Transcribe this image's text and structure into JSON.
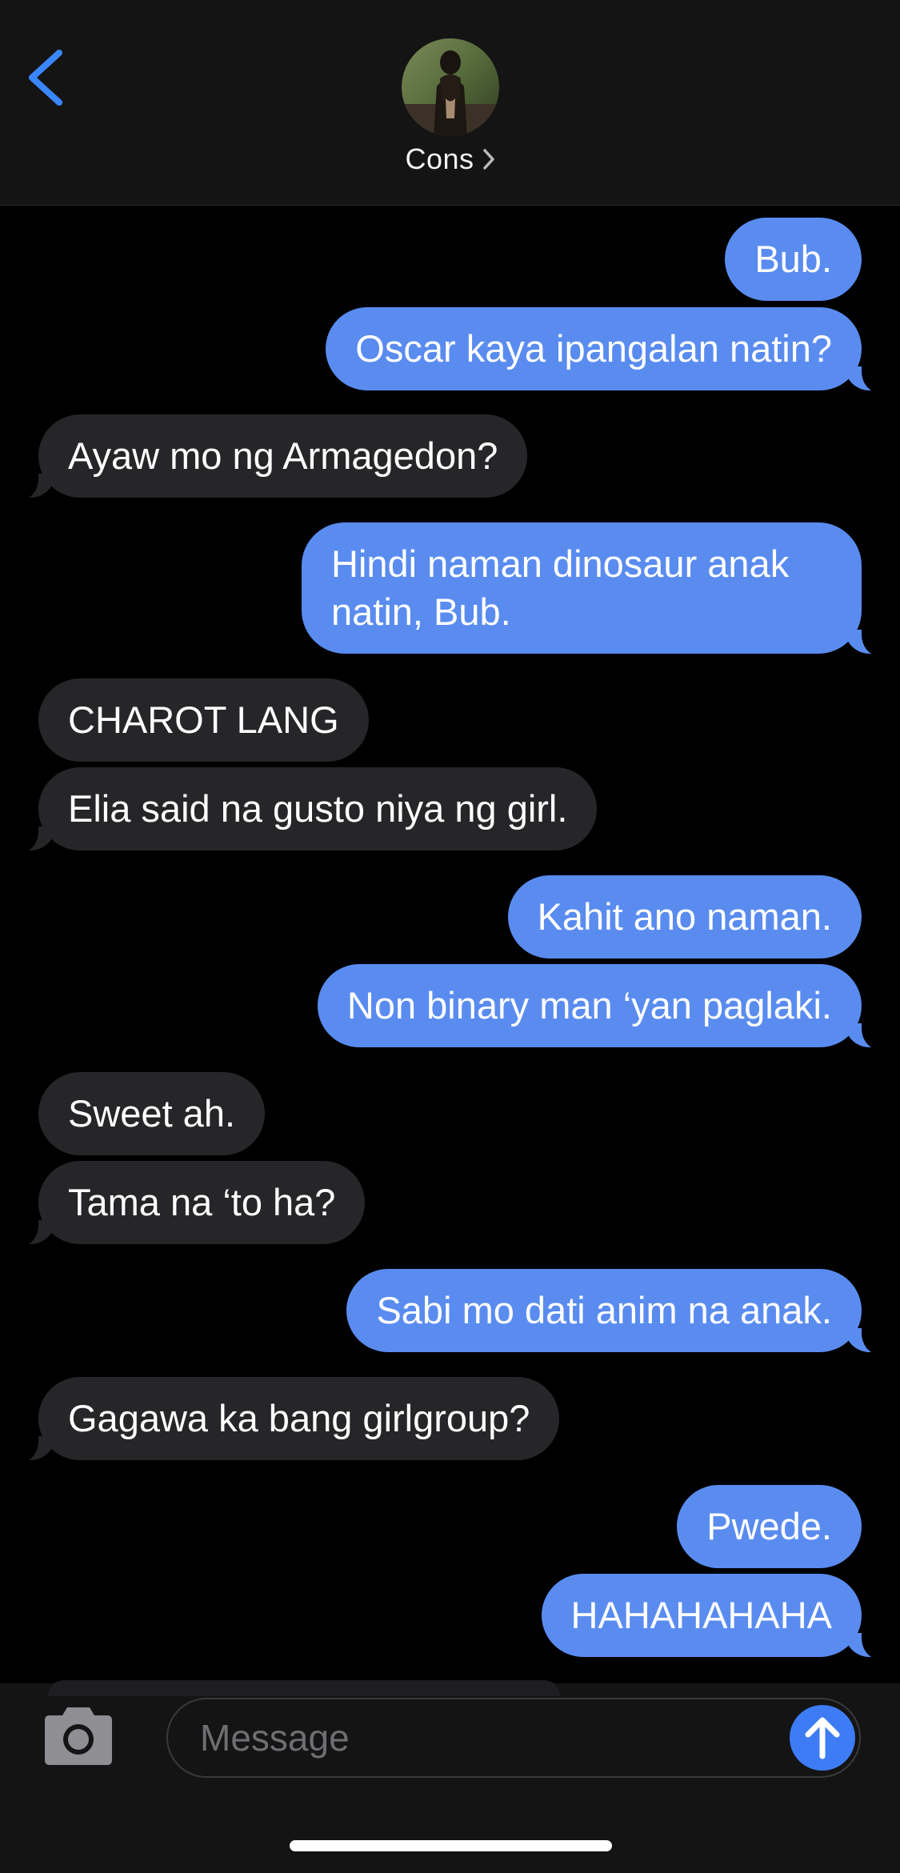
{
  "header": {
    "contact_name": "Cons",
    "back_icon": "chevron-left-icon",
    "contact_chevron_icon": "chevron-right-icon"
  },
  "messages": [
    {
      "from": "me",
      "text": "Bub."
    },
    {
      "from": "me",
      "text": "Oscar kaya ipangalan natin?"
    },
    {
      "from": "them",
      "text": "Ayaw mo ng Armagedon?"
    },
    {
      "from": "me",
      "text": "Hindi naman dinosaur anak natin, Bub."
    },
    {
      "from": "them",
      "text": "CHAROT LANG"
    },
    {
      "from": "them",
      "text": "Elia said na gusto niya ng girl."
    },
    {
      "from": "me",
      "text": "Kahit ano naman."
    },
    {
      "from": "me",
      "text": "Non binary man ‘yan paglaki."
    },
    {
      "from": "them",
      "text": "Sweet ah."
    },
    {
      "from": "them",
      "text": "Tama na ‘to ha?"
    },
    {
      "from": "me",
      "text": "Sabi mo dati anim na anak."
    },
    {
      "from": "them",
      "text": "Gagawa ka bang girlgroup?"
    },
    {
      "from": "me",
      "text": "Pwede."
    },
    {
      "from": "me",
      "text": "HAHAHAHAHA"
    }
  ],
  "composer": {
    "placeholder": "Message",
    "camera_icon": "camera-icon",
    "send_icon": "arrow-up-icon"
  },
  "colors": {
    "sent_bubble": "#5a8cf0",
    "received_bubble": "#262629",
    "accent": "#3d7cf4",
    "background": "#000000"
  }
}
